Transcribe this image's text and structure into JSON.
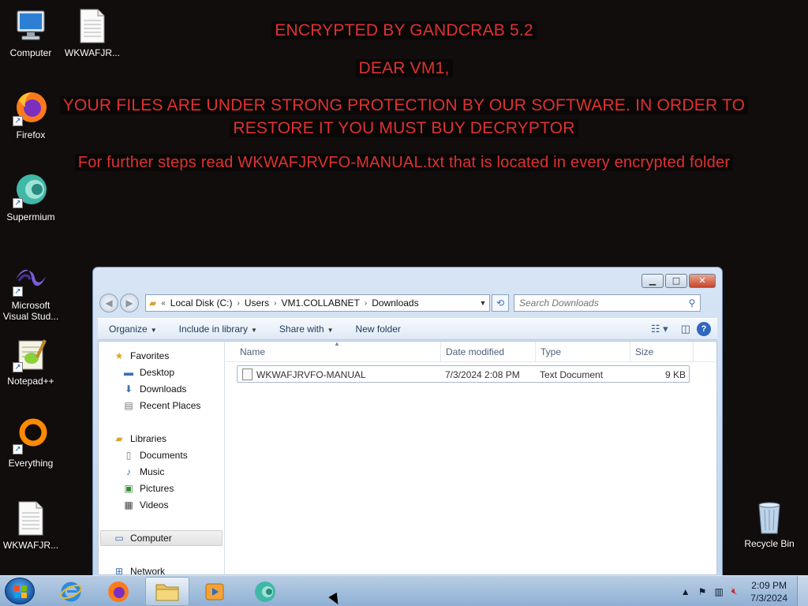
{
  "wallpaper": {
    "title": "ENCRYPTED BY GANDCRAB 5.2",
    "greeting": "DEAR VM1,",
    "line1": "YOUR FILES ARE UNDER STRONG PROTECTION BY OUR SOFTWARE. IN ORDER TO",
    "line2": "RESTORE IT YOU MUST BUY DECRYPTOR",
    "steps": "For further steps read WKWAFJRVFO-MANUAL.txt that is located in every encrypted folder",
    "text_color": "#e0322f"
  },
  "desktop_icons": [
    {
      "label": "Computer",
      "icon": "computer-icon"
    },
    {
      "label": "WKWAFJR...",
      "icon": "text-file-icon"
    },
    {
      "label": "Firefox",
      "icon": "firefox-icon"
    },
    {
      "label": "Supermium",
      "icon": "supermium-icon"
    },
    {
      "label": "Microsoft Visual Stud...",
      "icon": "visual-studio-icon"
    },
    {
      "label": "Notepad++",
      "icon": "notepad-plus-plus-icon"
    },
    {
      "label": "Everything",
      "icon": "everything-search-icon"
    },
    {
      "label": "WKWAFJR...",
      "icon": "text-file-icon"
    },
    {
      "label": "Recycle Bin",
      "icon": "recycle-bin-icon"
    }
  ],
  "explorer": {
    "address": {
      "crumbs": [
        "Local Disk (C:)",
        "Users",
        "VM1.COLLABNET",
        "Downloads"
      ]
    },
    "search_placeholder": "Search Downloads",
    "toolbar": {
      "organize": "Organize",
      "include_in_library": "Include in library",
      "share_with": "Share with",
      "new_folder": "New folder"
    },
    "nav_pane": {
      "favorites": "Favorites",
      "desktop": "Desktop",
      "downloads": "Downloads",
      "recent_places": "Recent Places",
      "libraries": "Libraries",
      "documents": "Documents",
      "music": "Music",
      "pictures": "Pictures",
      "videos": "Videos",
      "computer": "Computer",
      "network": "Network"
    },
    "columns": {
      "name": "Name",
      "date_modified": "Date modified",
      "type": "Type",
      "size": "Size"
    },
    "files": [
      {
        "name": "WKWAFJRVFO-MANUAL",
        "date_modified": "7/3/2024 2:08 PM",
        "type": "Text Document",
        "size": "9 KB"
      }
    ]
  },
  "taskbar": {
    "pinned": [
      "internet-explorer-icon",
      "firefox-icon",
      "explorer-folder-icon",
      "media-player-icon",
      "supermium-icon"
    ],
    "clock_time": "2:09 PM",
    "clock_date": "7/3/2024"
  }
}
